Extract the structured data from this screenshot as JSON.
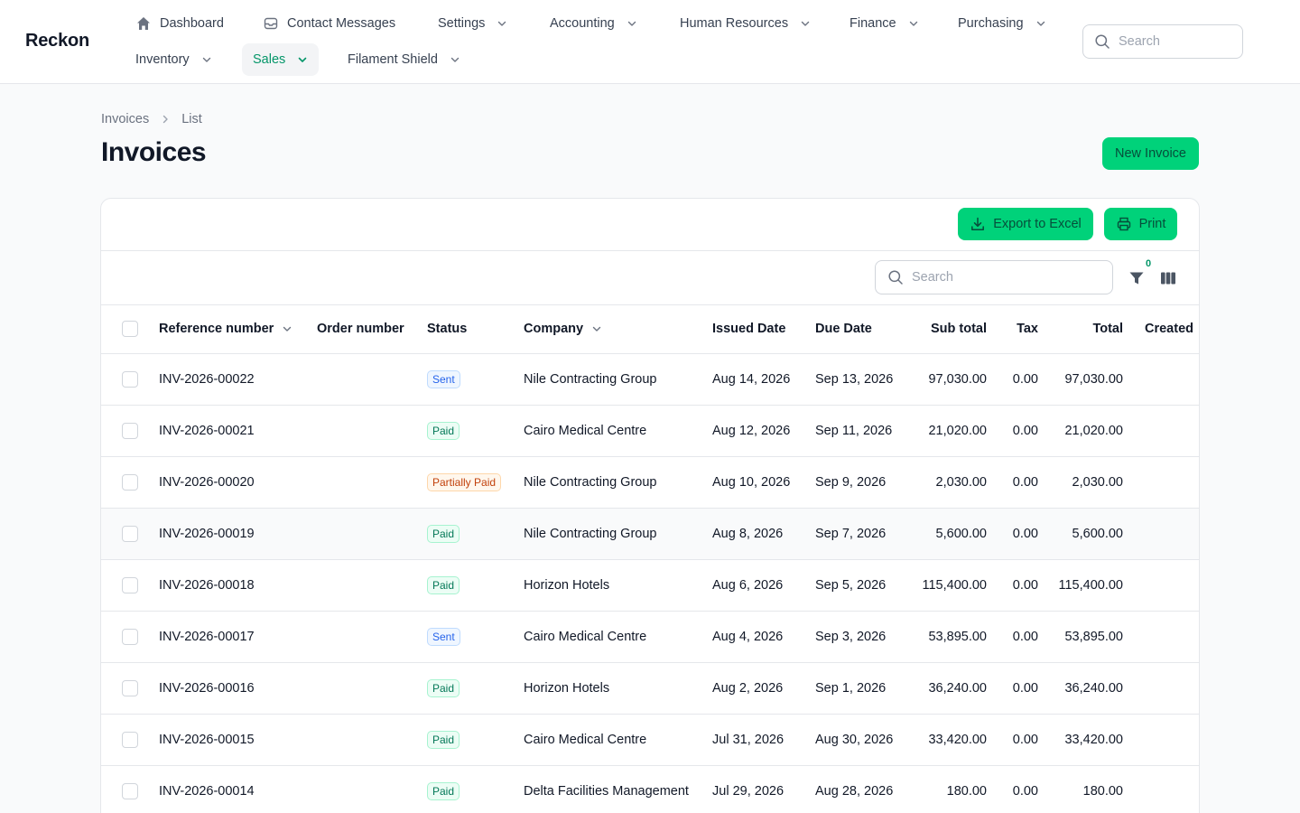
{
  "app": {
    "brand": "Reckon"
  },
  "nav": {
    "items": [
      {
        "label": "Dashboard",
        "icon": "home-icon"
      },
      {
        "label": "Contact Messages",
        "icon": "inbox-icon"
      },
      {
        "label": "Settings"
      },
      {
        "label": "Accounting"
      },
      {
        "label": "Human Resources"
      },
      {
        "label": "Finance"
      },
      {
        "label": "Purchasing"
      },
      {
        "label": "Inventory"
      },
      {
        "label": "Sales",
        "active": true
      },
      {
        "label": "Filament Shield"
      }
    ],
    "search_placeholder": "Search"
  },
  "breadcrumb": {
    "root": "Invoices",
    "current": "List"
  },
  "page": {
    "title": "Invoices",
    "new_button": "New Invoice"
  },
  "toolbar": {
    "export_label": "Export to Excel",
    "print_label": "Print",
    "search_placeholder": "Search",
    "filter_count": "0"
  },
  "table": {
    "columns": {
      "reference": "Reference number",
      "order": "Order number",
      "status": "Status",
      "company": "Company",
      "issued": "Issued Date",
      "due": "Due Date",
      "subtotal": "Sub total",
      "tax": "Tax",
      "total": "Total",
      "created": "Created"
    },
    "rows": [
      {
        "ref": "INV-2026-00022",
        "order": "",
        "status": "Sent",
        "company": "Nile Contracting Group",
        "issued": "Aug 14, 2026",
        "due": "Sep 13, 2026",
        "subtotal": "97,030.00",
        "tax": "0.00",
        "total": "97,030.00"
      },
      {
        "ref": "INV-2026-00021",
        "order": "",
        "status": "Paid",
        "company": "Cairo Medical Centre",
        "issued": "Aug 12, 2026",
        "due": "Sep 11, 2026",
        "subtotal": "21,020.00",
        "tax": "0.00",
        "total": "21,020.00"
      },
      {
        "ref": "INV-2026-00020",
        "order": "",
        "status": "Partially Paid",
        "company": "Nile Contracting Group",
        "issued": "Aug 10, 2026",
        "due": "Sep 9, 2026",
        "subtotal": "2,030.00",
        "tax": "0.00",
        "total": "2,030.00"
      },
      {
        "ref": "INV-2026-00019",
        "order": "",
        "status": "Paid",
        "company": "Nile Contracting Group",
        "issued": "Aug 8, 2026",
        "due": "Sep 7, 2026",
        "subtotal": "5,600.00",
        "tax": "0.00",
        "total": "5,600.00"
      },
      {
        "ref": "INV-2026-00018",
        "order": "",
        "status": "Paid",
        "company": "Horizon Hotels",
        "issued": "Aug 6, 2026",
        "due": "Sep 5, 2026",
        "subtotal": "115,400.00",
        "tax": "0.00",
        "total": "115,400.00"
      },
      {
        "ref": "INV-2026-00017",
        "order": "",
        "status": "Sent",
        "company": "Cairo Medical Centre",
        "issued": "Aug 4, 2026",
        "due": "Sep 3, 2026",
        "subtotal": "53,895.00",
        "tax": "0.00",
        "total": "53,895.00"
      },
      {
        "ref": "INV-2026-00016",
        "order": "",
        "status": "Paid",
        "company": "Horizon Hotels",
        "issued": "Aug 2, 2026",
        "due": "Sep 1, 2026",
        "subtotal": "36,240.00",
        "tax": "0.00",
        "total": "36,240.00"
      },
      {
        "ref": "INV-2026-00015",
        "order": "",
        "status": "Paid",
        "company": "Cairo Medical Centre",
        "issued": "Jul 31, 2026",
        "due": "Aug 30, 2026",
        "subtotal": "33,420.00",
        "tax": "0.00",
        "total": "33,420.00"
      },
      {
        "ref": "INV-2026-00014",
        "order": "",
        "status": "Paid",
        "company": "Delta Facilities Management",
        "issued": "Jul 29, 2026",
        "due": "Aug 28, 2026",
        "subtotal": "180.00",
        "tax": "0.00",
        "total": "180.00"
      }
    ]
  },
  "colors": {
    "accent": "#00d27a",
    "active_nav": "#059669",
    "sent": "#2563eb",
    "paid": "#047857",
    "partial": "#c2410c"
  }
}
